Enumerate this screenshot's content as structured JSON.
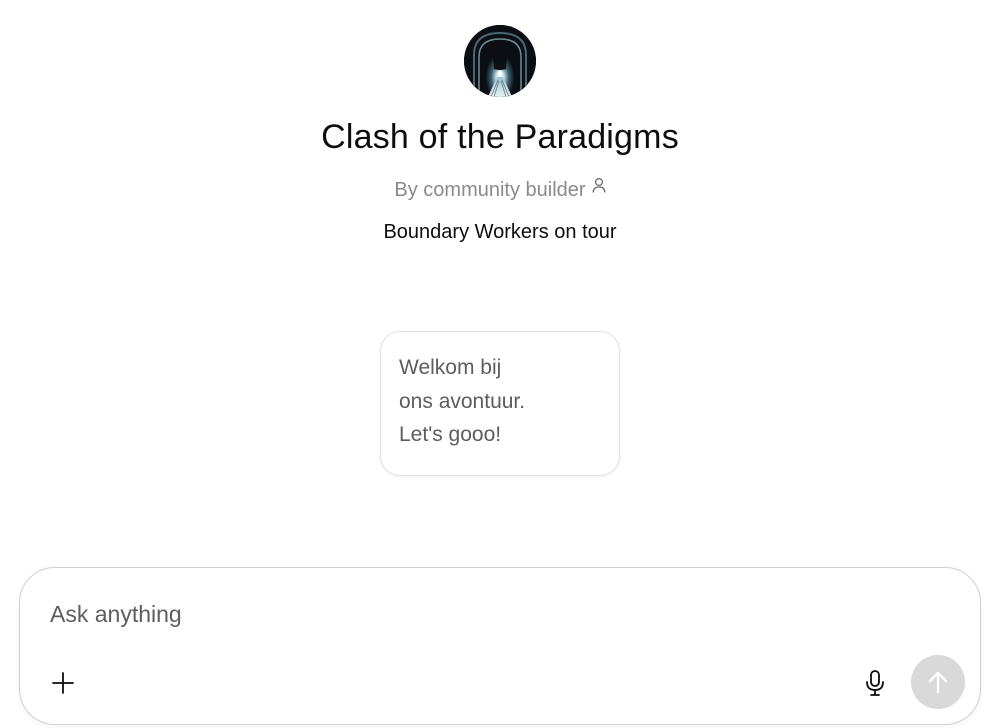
{
  "gpt": {
    "name": "Clash of the Paradigms",
    "byline": "By community builder",
    "description": "Boundary Workers on tour",
    "avatar_icon": "tunnel-figure-avatar"
  },
  "conversation_starters": [
    {
      "lines": [
        "Welkom bij",
        "ons avontuur.",
        "Let's gooo!"
      ]
    }
  ],
  "composer": {
    "placeholder": "Ask anything",
    "value": "",
    "icons": {
      "attach": "plus-icon",
      "voice": "microphone-icon",
      "send": "arrow-up-icon"
    }
  },
  "colors": {
    "send_button_disabled": "#d9d9d9",
    "secondary_text": "#8a8a8a",
    "card_text": "#5d5d5d"
  }
}
